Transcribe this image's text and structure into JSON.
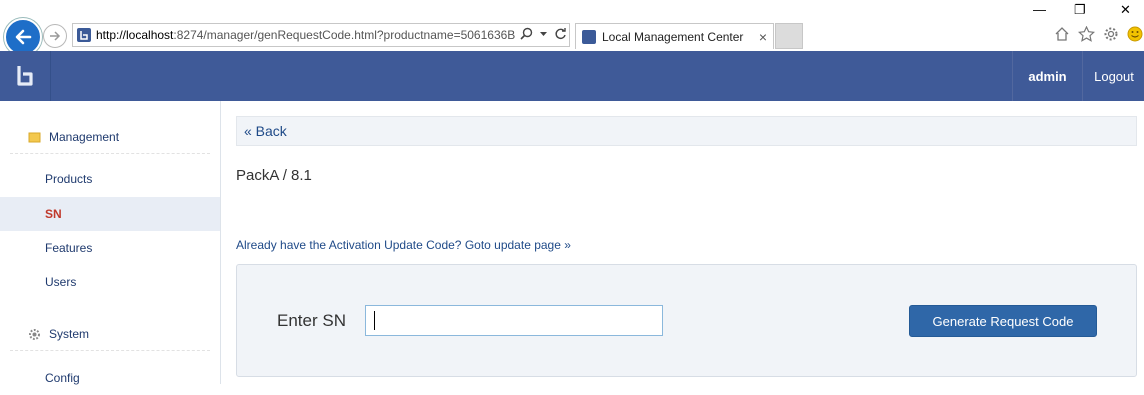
{
  "browser": {
    "url_host": "http://localhost",
    "url_rest": ":8274/manager/genRequestCode.html?productname=5061636B",
    "tab_title": "Local Management Center",
    "tab_close": "×",
    "win_minimize": "—",
    "win_restore": "❐",
    "win_close": "✕"
  },
  "header": {
    "user": "admin",
    "logout": "Logout"
  },
  "sidebar": {
    "sections": [
      {
        "label": "Management",
        "icon": "folder-icon"
      },
      {
        "label": "System",
        "icon": "gear-icon"
      }
    ],
    "items": [
      {
        "label": "Products"
      },
      {
        "label": "SN",
        "active": true
      },
      {
        "label": "Features"
      },
      {
        "label": "Users"
      },
      {
        "label": "Config"
      }
    ]
  },
  "main": {
    "back_link": "« Back",
    "breadcrumb": "PackA / 8.1",
    "update_link": "Already have the Activation Update Code? Goto update page »",
    "sn_label": "Enter SN",
    "sn_value": "",
    "generate_button": "Generate Request Code"
  },
  "colors": {
    "header_bg": "#3f5a98",
    "button_bg": "#2f67a8",
    "active_item": "#c0392b"
  }
}
